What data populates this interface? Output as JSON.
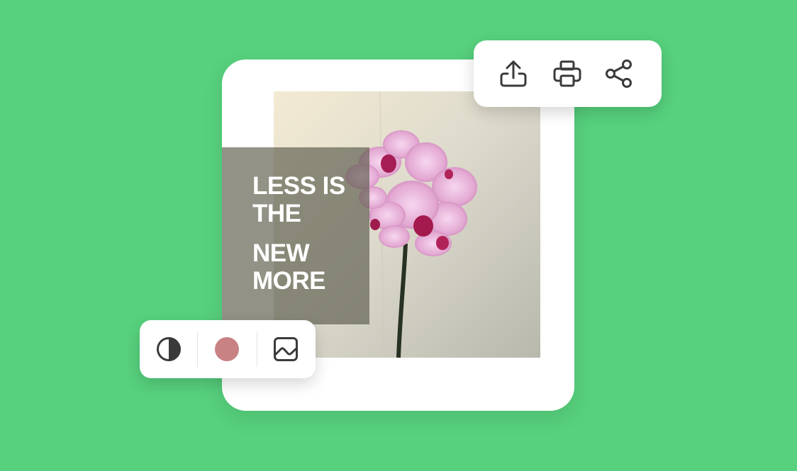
{
  "background_color": "#57d17d",
  "poster": {
    "headline_lines": [
      "LESS IS",
      "THE",
      "NEW",
      "MORE"
    ],
    "photo_subject": "pink orchid stem against a beige wall"
  },
  "action_toolbar": {
    "buttons": [
      {
        "icon": "upload-icon"
      },
      {
        "icon": "print-icon"
      },
      {
        "icon": "share-icon"
      }
    ]
  },
  "edit_toolbar": {
    "buttons": [
      {
        "icon": "contrast-icon"
      },
      {
        "icon": "color-swatch",
        "color": "#c98283"
      },
      {
        "icon": "image-icon"
      }
    ]
  },
  "colors": {
    "icon": "#3a3a3a",
    "card": "#ffffff"
  }
}
